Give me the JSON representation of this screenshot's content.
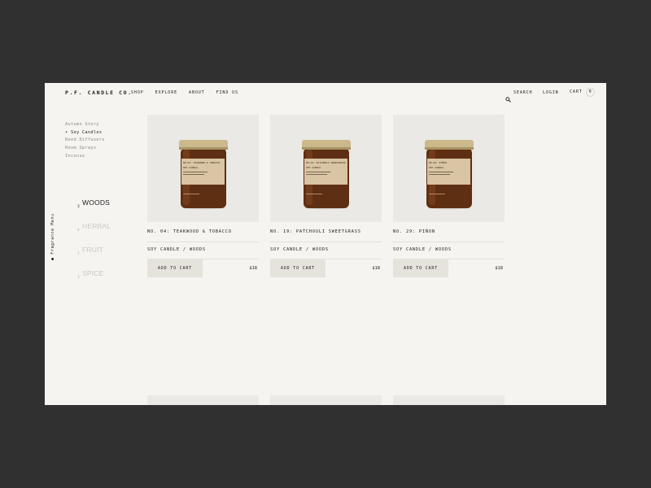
{
  "header": {
    "logo": "P.F. CANDLE CO.",
    "nav": [
      "SHOP",
      "EXPLORE",
      "ABOUT",
      "FIND US"
    ],
    "search_label": "SEARCH",
    "login_label": "LOGIN",
    "cart_label": "CART",
    "cart_count": "0"
  },
  "sidebar": {
    "categories": [
      {
        "label": "Autumn Story",
        "active": false
      },
      {
        "label": "• Soy Candles",
        "active": true
      },
      {
        "label": "Reed Diffusers",
        "active": false
      },
      {
        "label": "Room Sprays",
        "active": false
      },
      {
        "label": "Incense",
        "active": false
      }
    ],
    "fragrance_menu_label": "● Fragrance Menu",
    "families": [
      {
        "num": "3",
        "name": "WOODS",
        "active": true
      },
      {
        "num": "4",
        "name": "HERBAL",
        "active": false
      },
      {
        "num": "2",
        "name": "FRUIT",
        "active": false
      },
      {
        "num": "3",
        "name": "SPICE",
        "active": false
      }
    ]
  },
  "products": [
    {
      "name": "NO. 04: TEAKWOOD & TOBACCO",
      "type": "SOY CANDLE / WOODS",
      "button": "ADD TO CART",
      "price": "$18",
      "label_line1": "NO.04: TEAKWOOD & TOBACCO",
      "label_line2": "SOY CANDLE"
    },
    {
      "name": "NO. 19: PATCHOULI SWEETGRASS",
      "type": "SOY CANDLE / WOODS",
      "button": "ADD TO CART",
      "price": "$18",
      "label_line1": "NO.19: PATCHOULI SWEETGRASS",
      "label_line2": "SOY CANDLE"
    },
    {
      "name": "NO. 29: PIÑON",
      "type": "SOY CANDLE / WOODS",
      "button": "ADD TO CART",
      "price": "$18",
      "label_line1": "NO.29: PIÑON",
      "label_line2": "SOY CANDLE"
    }
  ],
  "colors": {
    "outer_background": "#303030",
    "page_background": "#f5f4f0",
    "image_background": "#ebe9e5",
    "button_background": "#e6e3dd",
    "jar_amber": "#6e3a17",
    "lid_gold": "#cbb98c",
    "label_kraft": "#d9c4a3"
  }
}
